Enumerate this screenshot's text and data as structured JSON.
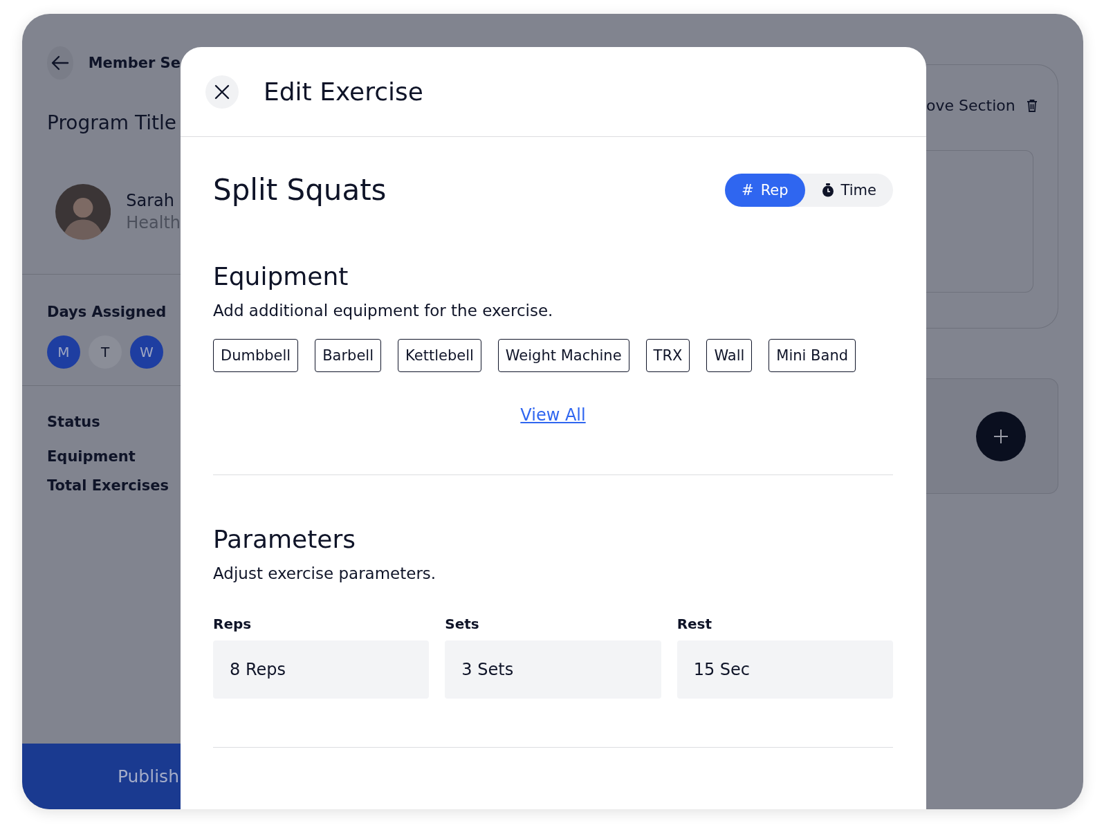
{
  "background": {
    "back_title": "Member Se",
    "program_title": "Program Title",
    "coach": {
      "name": "Sarah",
      "role": "Health"
    },
    "days_label": "Days Assigned",
    "days": [
      {
        "label": "M",
        "selected": true
      },
      {
        "label": "T",
        "selected": false
      },
      {
        "label": "W",
        "selected": true
      }
    ],
    "summary": [
      "Status",
      "Equipment",
      "Total Exercises"
    ],
    "publish": "Publish",
    "section_action": "ove Section"
  },
  "modal": {
    "title": "Edit Exercise",
    "exercise": "Split Squats",
    "modes": [
      {
        "kind": "count",
        "symbol": "#",
        "label": "Rep",
        "selected": true
      },
      {
        "kind": "timer",
        "label": "Time",
        "selected": false
      }
    ],
    "equipment": {
      "heading": "Equipment",
      "description": "Add additional equipment for the exercise.",
      "tags": [
        "Dumbbell",
        "Barbell",
        "Kettlebell",
        "Weight Machine",
        "TRX",
        "Wall",
        "Mini Band"
      ],
      "link": "View All"
    },
    "parameters": {
      "heading": "Parameters",
      "description": "Adjust exercise parameters.",
      "fields": [
        {
          "label": "Reps",
          "value": "8 Reps"
        },
        {
          "label": "Sets",
          "value": "3 Sets"
        },
        {
          "label": "Rest",
          "value": "15 Sec"
        }
      ]
    }
  }
}
